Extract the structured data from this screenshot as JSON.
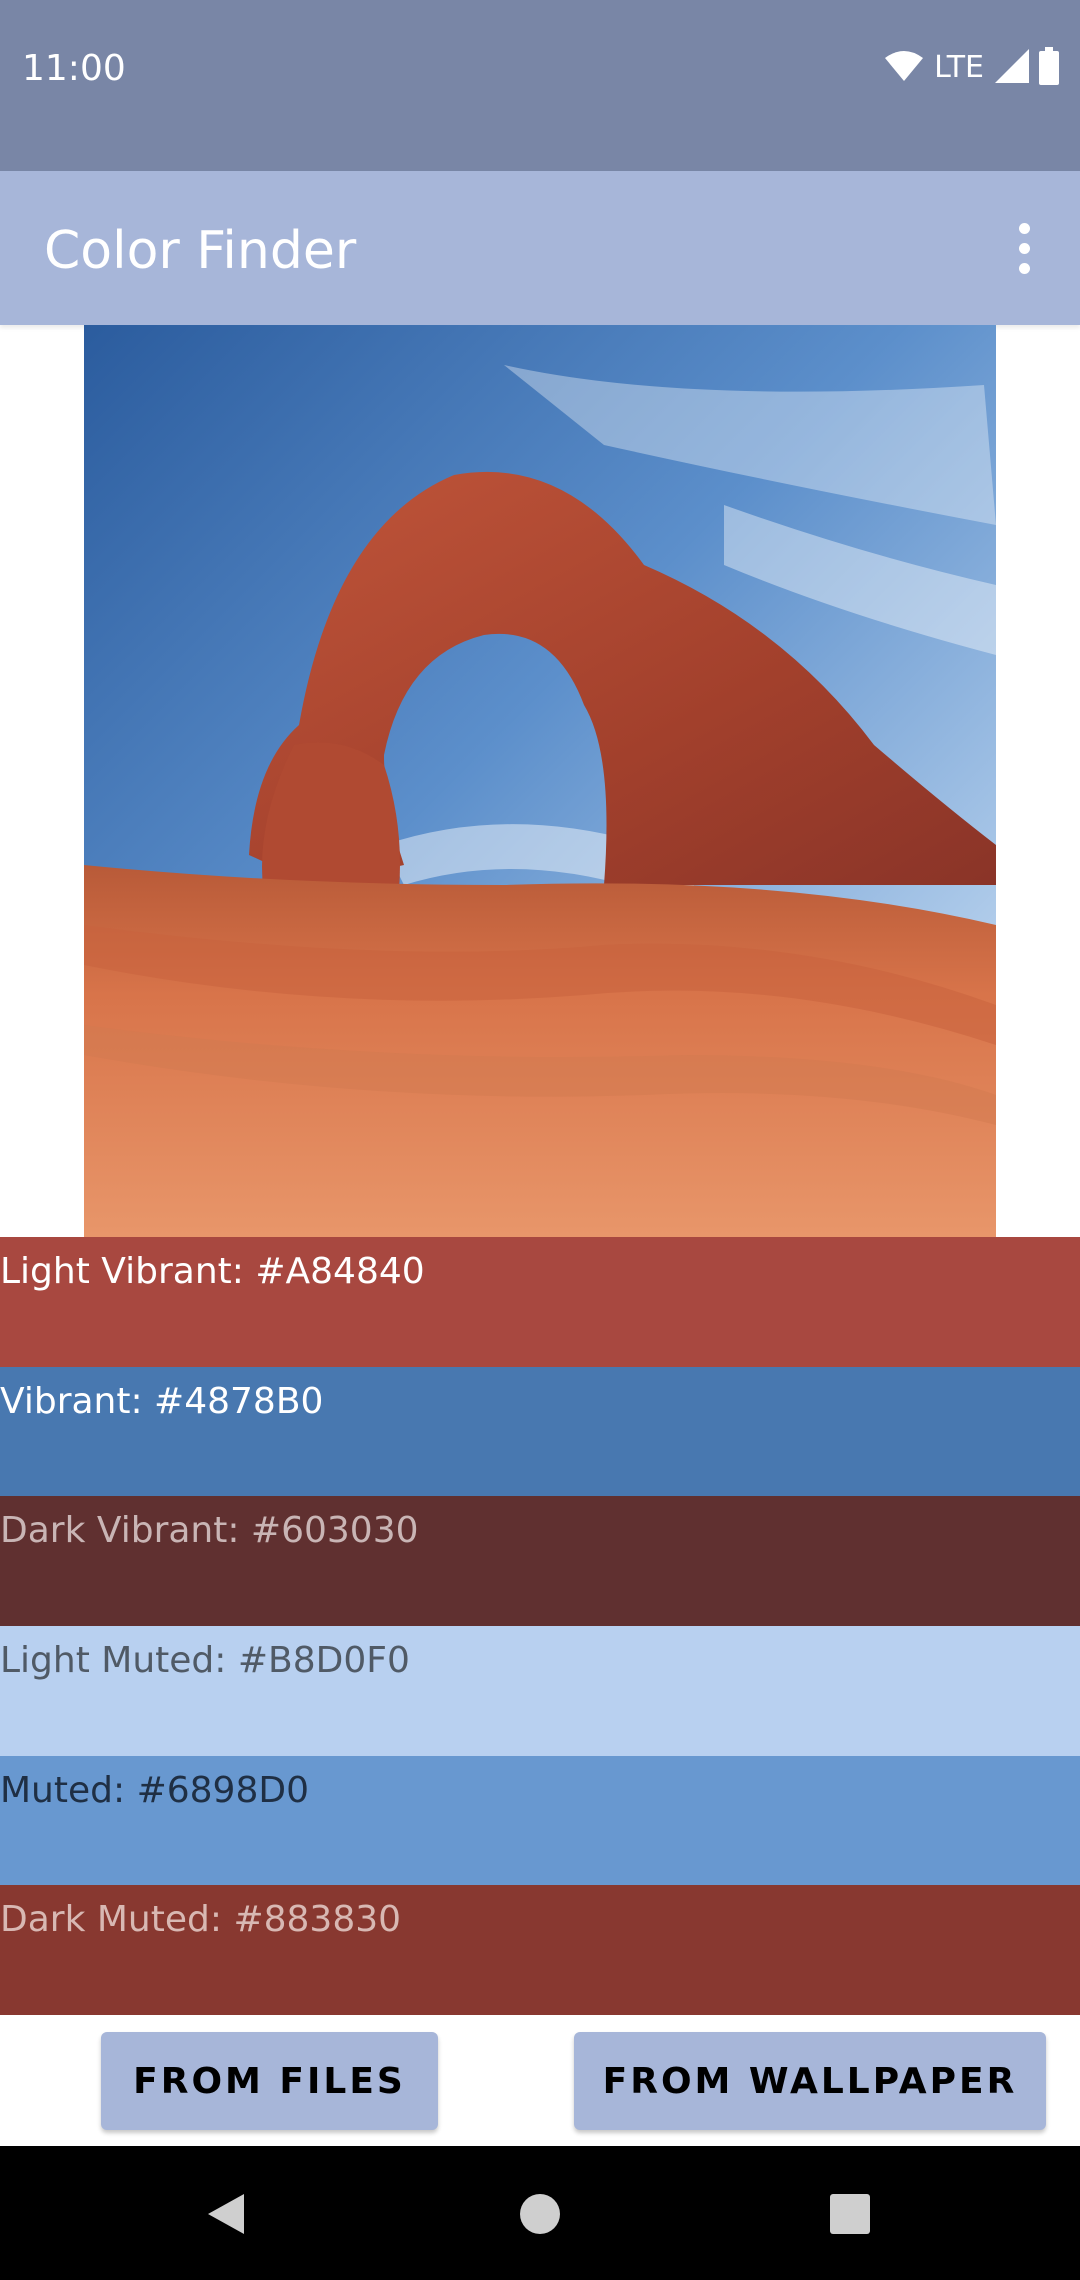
{
  "status_bar": {
    "time": "11:00",
    "network": "LTE",
    "icons": [
      "wifi-icon",
      "signal-icon",
      "battery-icon"
    ]
  },
  "app_bar": {
    "title": "Color Finder",
    "menu_icon": "more-vert-icon"
  },
  "image": {
    "description_icon": "selected-photo"
  },
  "palette": [
    {
      "label": "Light Vibrant: #A84840",
      "color": "#A84840",
      "text_color": "#FFFFFF"
    },
    {
      "label": "Vibrant: #4878B0",
      "color": "#4878B0",
      "text_color": "#FFFFFF"
    },
    {
      "label": "Dark Vibrant: #603030",
      "color": "#603030",
      "text_color": "#C9B5B5"
    },
    {
      "label": "Light Muted: #B8D0F0",
      "color": "#B8D0F0",
      "text_color": "#505A66"
    },
    {
      "label": "Muted: #6898D0",
      "color": "#6898D0",
      "text_color": "#1F2F44"
    },
    {
      "label": "Dark Muted: #883830",
      "color": "#883830",
      "text_color": "#D8B8B3"
    }
  ],
  "buttons": {
    "from_files": "FROM FILES",
    "from_wallpaper": "FROM WALLPAPER"
  },
  "nav_bar": {
    "icons": [
      "back-icon",
      "home-icon",
      "recents-icon"
    ]
  },
  "colors": {
    "status_bar": "#7986A6",
    "app_bar": "#A7B6D9",
    "button": "#A7B6D9"
  }
}
